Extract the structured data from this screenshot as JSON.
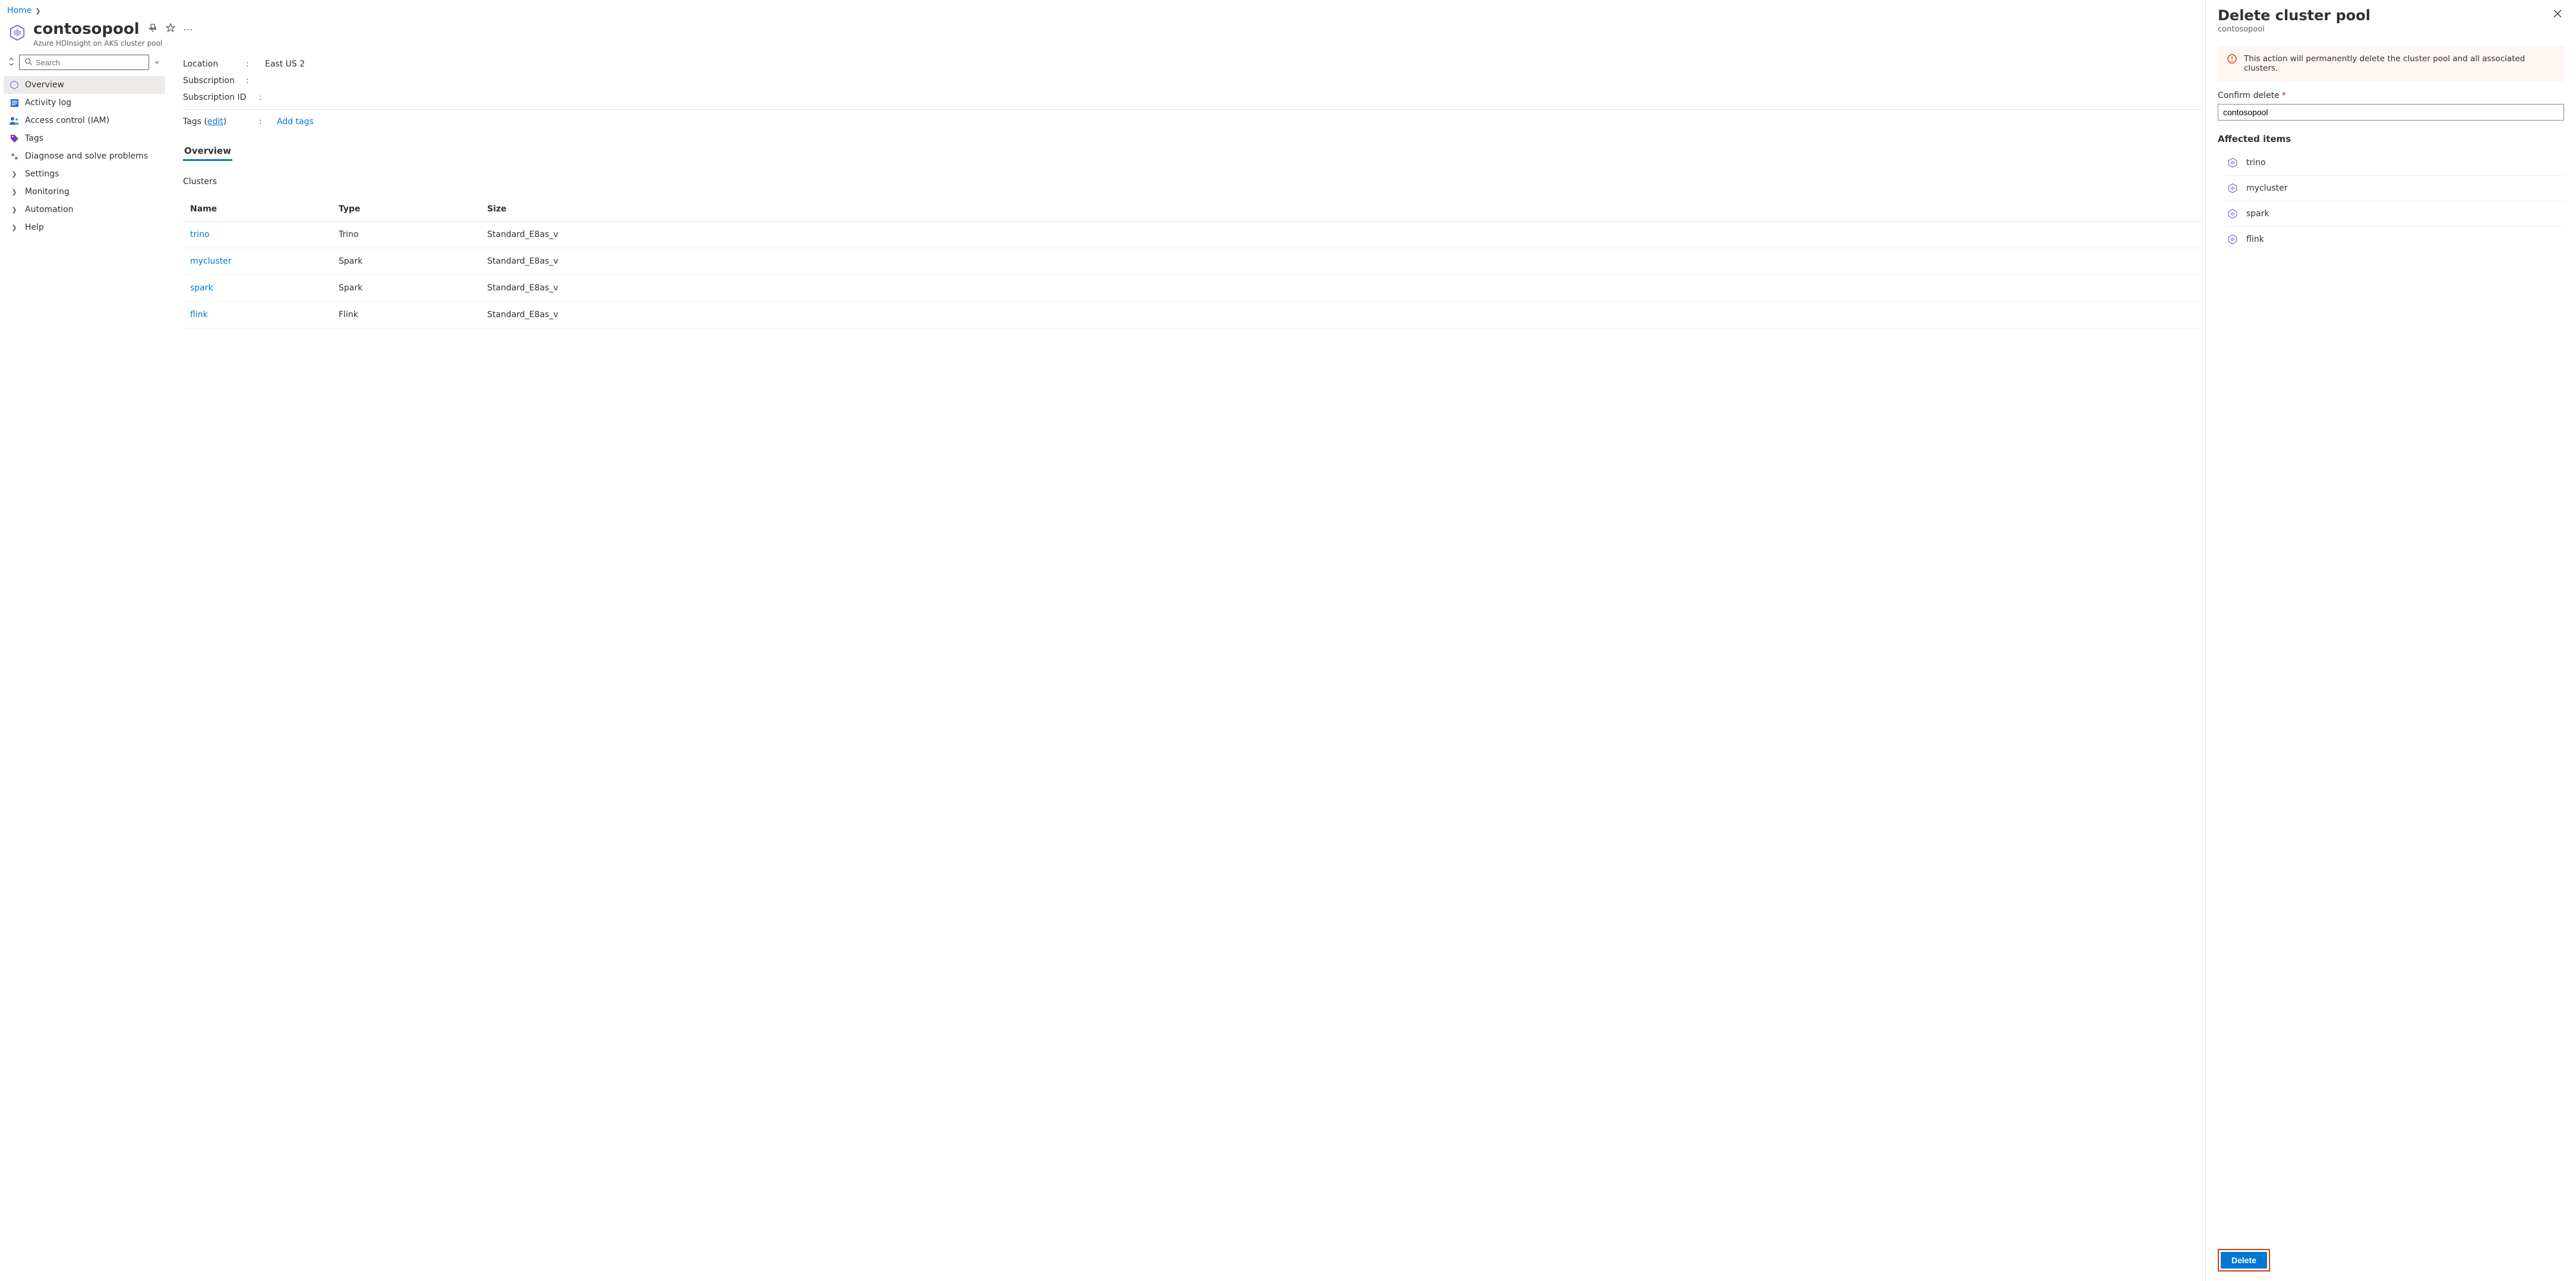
{
  "breadcrumb": {
    "home": "Home"
  },
  "header": {
    "title": "contosopool",
    "subtitle": "Azure HDInsight on AKS cluster pool"
  },
  "search": {
    "placeholder": "Search"
  },
  "nav": {
    "overview": "Overview",
    "activity": "Activity log",
    "iam": "Access control (IAM)",
    "tags": "Tags",
    "diagnose": "Diagnose and solve problems",
    "settings": "Settings",
    "monitoring": "Monitoring",
    "automation": "Automation",
    "help": "Help"
  },
  "props": {
    "location_label": "Location",
    "location_value": "East US 2",
    "subscription_label": "Subscription",
    "subscription_value": "",
    "subscription_id_label": "Subscription ID",
    "subscription_id_value": "",
    "tags_label": "Tags",
    "tags_edit": "edit",
    "add_tags": "Add tags"
  },
  "tabs": {
    "overview": "Overview"
  },
  "clusters_label": "Clusters",
  "table": {
    "cols": {
      "name": "Name",
      "type": "Type",
      "size": "Size"
    },
    "rows": [
      {
        "name": "trino",
        "type": "Trino",
        "size": "Standard_E8as_v"
      },
      {
        "name": "mycluster",
        "type": "Spark",
        "size": "Standard_E8as_v"
      },
      {
        "name": "spark",
        "type": "Spark",
        "size": "Standard_E8as_v"
      },
      {
        "name": "flink",
        "type": "Flink",
        "size": "Standard_E8as_v"
      }
    ]
  },
  "panel": {
    "title": "Delete cluster pool",
    "subtitle": "contosopool",
    "warning": "This action will permanently delete the cluster pool and all associated clusters.",
    "confirm_label": "Confirm delete",
    "confirm_value": "contosopool",
    "affected_label": "Affected items",
    "affected": [
      "trino",
      "mycluster",
      "spark",
      "flink"
    ],
    "delete_button": "Delete"
  }
}
